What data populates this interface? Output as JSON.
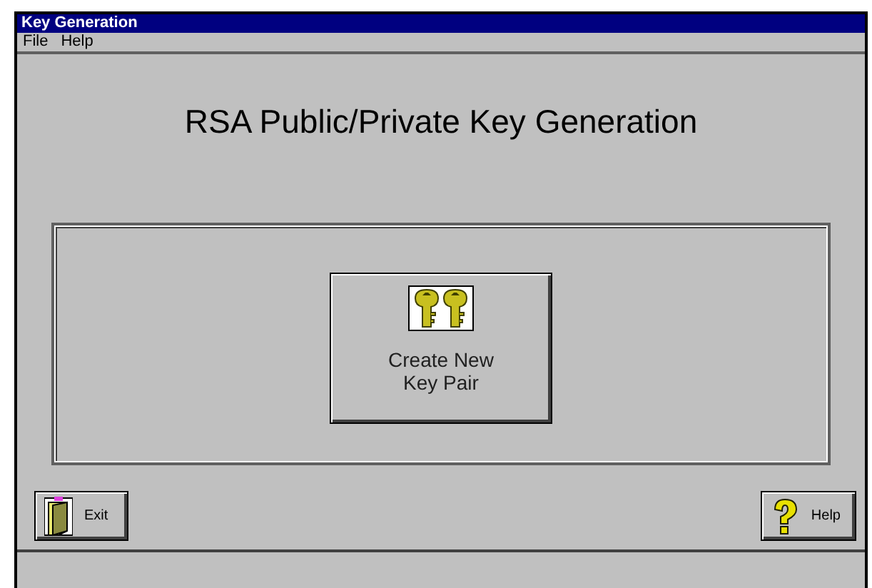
{
  "window": {
    "title": "Key Generation"
  },
  "menu": [
    "File",
    "Help"
  ],
  "heading": "RSA Public/Private Key Generation",
  "main_button": {
    "label": [
      "Create New",
      "Key Pair"
    ]
  },
  "buttons": [
    {
      "kind": "exit",
      "label": "Exit"
    },
    {
      "kind": "help",
      "label": "Help"
    }
  ]
}
